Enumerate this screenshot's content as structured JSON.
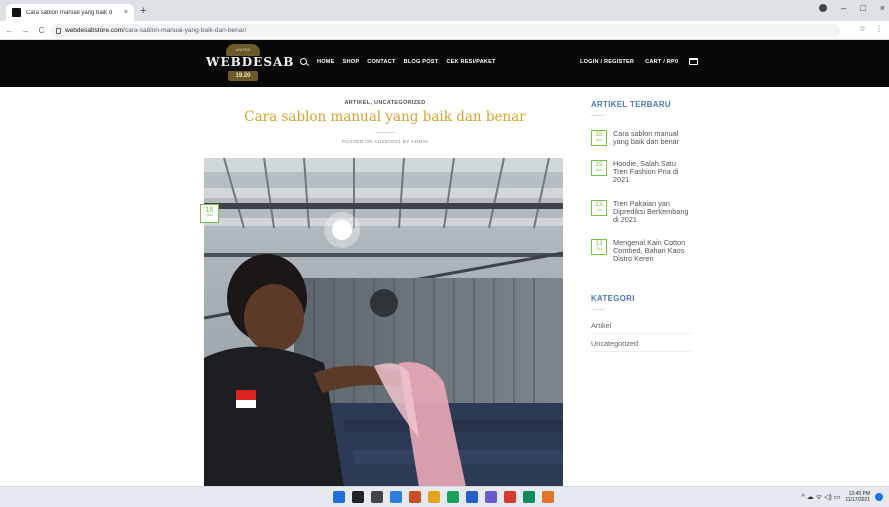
{
  "browser": {
    "tab_title": "Cara sablon manual yang baik d",
    "tab_close": "×",
    "new_tab": "+",
    "url_host": "webdesabstore.com",
    "url_path": "/cara-sablon-manual-yang-baik-dan-benar/",
    "back": "←",
    "forward": "→",
    "reload": "C",
    "star": "☆",
    "menu": "⋮",
    "minimize": "–",
    "maximize": "□",
    "close": "×"
  },
  "header": {
    "logo_badge": "UNITED",
    "logo_text": "WEBDESAB",
    "logo_year": "19.20",
    "nav": [
      "HOME",
      "SHOP",
      "CONTACT",
      "BLOG POST",
      "CEK RESI/PAKET"
    ],
    "login": "LOGIN / REGISTER",
    "cart": "CART / RP0"
  },
  "article": {
    "categories": "ARTIKEL, UNCATEGORIZED",
    "title": "Cara sablon manual yang baik dan benar",
    "posted_on": "POSTED ON 11/15/2021 BY ADMIN",
    "badge_day": "15",
    "badge_month": "Nov"
  },
  "sidebar": {
    "recent_title": "ARTIKEL TERBARU",
    "recent": [
      {
        "day": "15",
        "month": "Nov",
        "text": "Cara sablon manual yang baik dan benar"
      },
      {
        "day": "19",
        "month": "Nov",
        "text": "Hoodie, Salah Satu Tren Fashion Pria di 2021"
      },
      {
        "day": "13",
        "month": "Oct",
        "text": "Tren Pakaian yan Diprediksi Berkembang di 2021"
      },
      {
        "day": "13",
        "month": "Oct",
        "text": "Mengenal Kain Cotton Combed, Bahan Kaos Distro Keren"
      }
    ],
    "category_title": "KATEGORI",
    "categories": [
      "Artikel",
      "Uncategorized"
    ]
  },
  "taskbar": {
    "time": "12:45 PM",
    "date": "11/17/2021",
    "tray_icons": "^ ☁ ᯤ ◁) ▭",
    "colors": [
      "#1e6fd9",
      "#222222",
      "#444444",
      "#2f7de1",
      "#c94f2a",
      "#e8a21c",
      "#1aa35b",
      "#2460c8",
      "#6a5acd",
      "#d23b2f",
      "#0e8a5f",
      "#e2742a"
    ]
  }
}
